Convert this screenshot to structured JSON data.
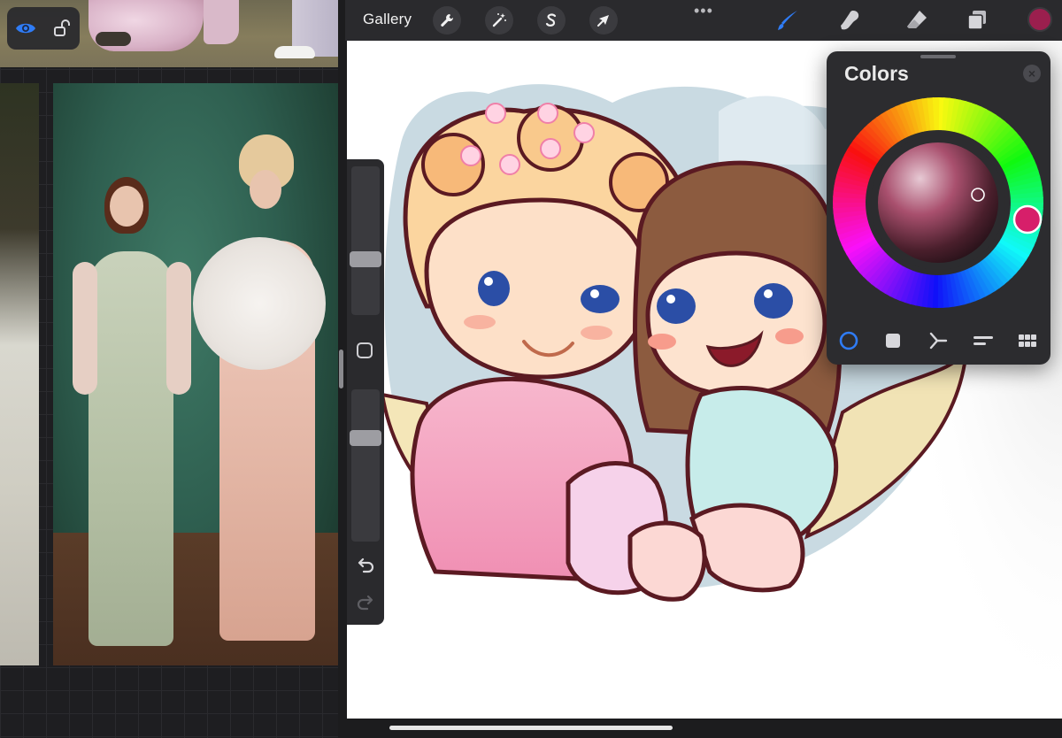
{
  "reference": {
    "toolbar": {
      "visibility_icon": "eye-icon",
      "lock_icon": "unlock-icon"
    }
  },
  "top_bar": {
    "gallery_label": "Gallery",
    "actions": [
      {
        "name": "actions",
        "icon": "wrench-icon"
      },
      {
        "name": "adjustments",
        "icon": "magic-wand-icon"
      },
      {
        "name": "selection",
        "icon": "selection-s-icon"
      },
      {
        "name": "transform",
        "icon": "arrow-cursor-icon"
      }
    ],
    "more_label": "•••",
    "tools": [
      {
        "name": "brush",
        "icon": "brush-icon",
        "active": true
      },
      {
        "name": "smudge",
        "icon": "smudge-icon",
        "active": false
      },
      {
        "name": "eraser",
        "icon": "eraser-icon",
        "active": false
      },
      {
        "name": "layers",
        "icon": "layers-icon",
        "active": false
      }
    ],
    "current_color": "#9b1f4e",
    "accent_color": "#2f7cf6"
  },
  "side_panel": {
    "brush_size_label": "Brush size",
    "opacity_label": "Opacity",
    "modify_icon": "square-icon",
    "undo_icon": "undo-icon",
    "redo_icon": "redo-icon"
  },
  "colors_panel": {
    "title": "Colors",
    "close_icon": "close-icon",
    "selected_color": "#d71f6a",
    "tabs": [
      {
        "name": "disc",
        "icon": "disc-icon",
        "active": true
      },
      {
        "name": "classic",
        "icon": "classic-square-icon",
        "active": false
      },
      {
        "name": "harmony",
        "icon": "harmony-icon",
        "active": false
      },
      {
        "name": "value",
        "icon": "value-sliders-icon",
        "active": false
      },
      {
        "name": "palettes",
        "icon": "palette-grid-icon",
        "active": false
      }
    ]
  }
}
